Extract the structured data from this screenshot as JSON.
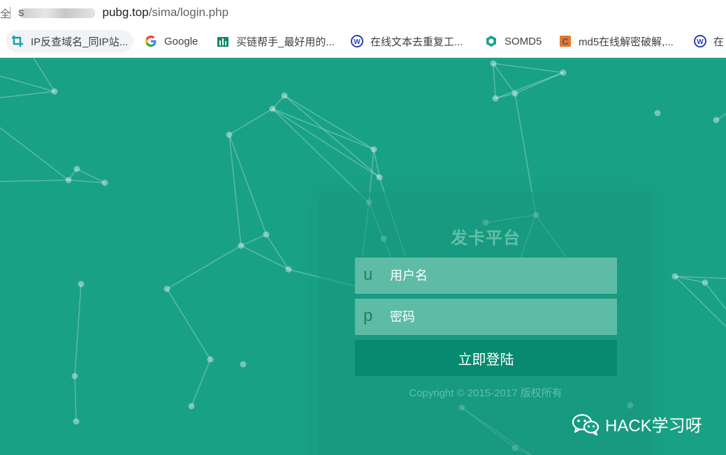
{
  "address_bar": {
    "lock_glyph": "全",
    "url_prefix": "s",
    "url_host": "pubg.top",
    "url_path": "/sima/login.php"
  },
  "bookmarks": [
    {
      "label": "IP反查域名_同IP站...",
      "icon": "crop-icon"
    },
    {
      "label": "Google",
      "icon": "google-icon"
    },
    {
      "label": "买链帮手_最好用的...",
      "icon": "chart-icon"
    },
    {
      "label": "在线文本去重复工...",
      "icon": "baidu-tool-icon"
    },
    {
      "label": "SOMD5",
      "icon": "somd5-icon"
    },
    {
      "label": "md5在线解密破解,...",
      "icon": "cmd5-icon"
    },
    {
      "label": "在",
      "icon": "baidu-tool-icon"
    }
  ],
  "login": {
    "title": "发卡平台",
    "username_prefix": "u",
    "username_placeholder": "用户名",
    "password_prefix": "p",
    "password_placeholder": "密码",
    "submit_label": "立即登陆",
    "copyright": "Copyright © 2015-2017 版权所有"
  },
  "watermark": {
    "text": "HACK学习呀"
  },
  "colors": {
    "page_bg": "#19a185",
    "field_bg": "#5ebba6",
    "button_bg": "#078a6f",
    "title_text": "#5fc0a8"
  }
}
